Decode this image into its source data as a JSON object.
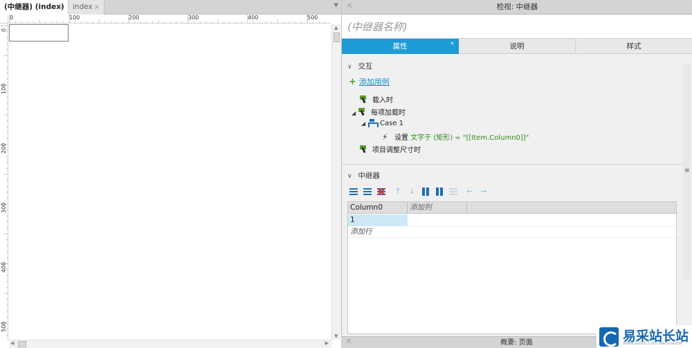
{
  "canvas_tabs": [
    {
      "label": "(中继器) (index)",
      "close": "×"
    },
    {
      "label": "index",
      "close": "×"
    }
  ],
  "tab_dropdown": "▼",
  "ruler_h": [
    "0",
    "100",
    "200",
    "300",
    "400",
    "500"
  ],
  "ruler_v": [
    "0",
    "100",
    "200",
    "300",
    "400",
    "500"
  ],
  "inspector": {
    "title": "检视: 中继器",
    "name_placeholder": "(中继器名称)",
    "tabs": {
      "properties": "属性",
      "properties_mark": "*",
      "notes": "说明",
      "style": "样式"
    }
  },
  "interaction": {
    "section_label": "交互",
    "add_case": "添加用例",
    "events": {
      "on_load": "载入时",
      "on_item_load": "每项加载时",
      "case1": "Case 1",
      "action_prefix": "设置 ",
      "action_detail": "文字于 (矩形) = \"[[Item.Column0]]\"",
      "on_item_resize": "项目调整尺寸时"
    }
  },
  "repeater": {
    "section_label": "中继器",
    "columns": [
      "Column0",
      "添加列"
    ],
    "rows": [
      [
        "1"
      ]
    ],
    "add_row": "添加行"
  },
  "status": {
    "text": "概要: 页面"
  },
  "logo": {
    "text": "易采站长站",
    "sub": "Www.Easck.Com Webmaster"
  },
  "colors": {
    "accent": "#1d9bd7",
    "selected_cell": "#cfe8f6",
    "green": "#2f8b1a",
    "link": "#1f8dc6"
  }
}
